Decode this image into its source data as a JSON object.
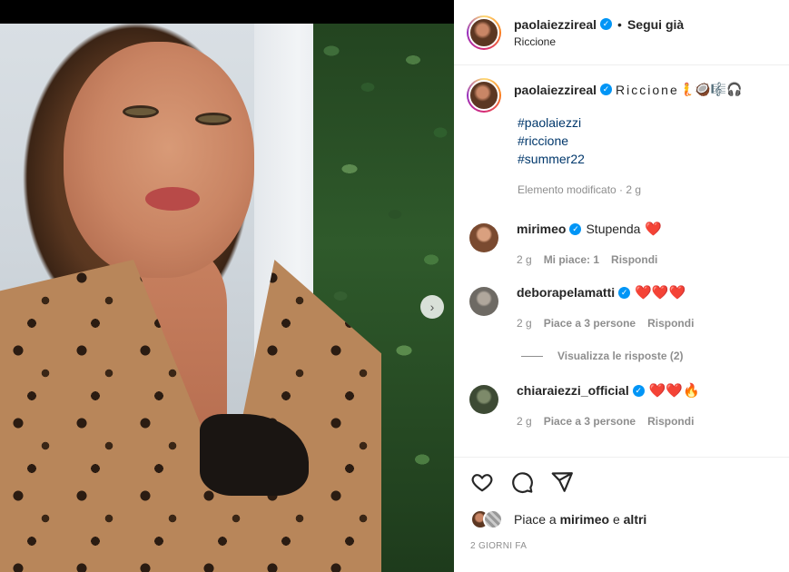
{
  "post": {
    "username": "paolaiezzireal",
    "follow_status": "Segui già",
    "separator": "•",
    "location": "Riccione",
    "caption_text": "Riccione",
    "caption_emojis": "🧜🥥🎼🎧",
    "hashtags": [
      "#paolaiezzi",
      "#riccione",
      "#summer22"
    ],
    "edited_meta": "Elemento modificato · 2 g"
  },
  "comments": [
    {
      "username": "mirimeo",
      "text": "Stupenda",
      "emojis": "❤️",
      "time": "2 g",
      "likes": "Mi piace: 1",
      "reply": "Rispondi",
      "avatar_color": "#7a4a30"
    },
    {
      "username": "deborapelamatti",
      "text": "",
      "emojis": "❤️❤️❤️",
      "time": "2 g",
      "likes": "Piace a 3 persone",
      "reply": "Rispondi",
      "avatar_color": "#6e6a64"
    },
    {
      "username": "chiaraiezzi_official",
      "text": "",
      "emojis": "❤️❤️🔥",
      "time": "2 g",
      "likes": "Piace a 3 persone",
      "reply": "Rispondi",
      "avatar_color": "#3d4a34"
    }
  ],
  "view_replies": "Visualizza le risposte (2)",
  "likes": {
    "prefix": "Piace a",
    "user": "mirimeo",
    "joiner": "e",
    "others": "altri"
  },
  "date": "2 GIORNI FA",
  "carousel_next": "›",
  "verified_mark": "✓",
  "icons": [
    "heart-icon",
    "comment-icon",
    "share-icon",
    "chevron-right-icon",
    "verified-icon"
  ]
}
